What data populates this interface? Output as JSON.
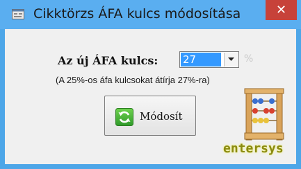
{
  "window": {
    "title": "Cikktörzs ÁFA kulcs módosítása",
    "close_glyph": "✕"
  },
  "form": {
    "label": "Az új ÁFA kulcs:",
    "combo_value": "27",
    "percent_symbol": "%",
    "hint": "(A 25%-os áfa kulcsokat átírja 27%-ra)"
  },
  "button": {
    "label": "Módosít",
    "icon": "refresh-icon"
  },
  "logo": {
    "text": "entersys",
    "icon": "abacus-icon"
  },
  "colors": {
    "titlebar": "#5aaef0",
    "close": "#c7423a",
    "selection": "#3399ff",
    "client": "#f0f0f0"
  }
}
